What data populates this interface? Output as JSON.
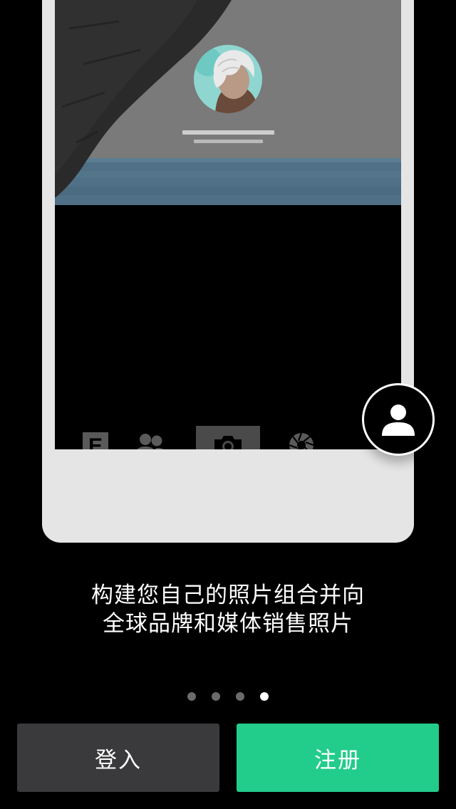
{
  "onboarding": {
    "caption_line1": "构建您自己的照片组合并向",
    "caption_line2": "全球品牌和媒体销售照片",
    "page_indicator": {
      "total": 4,
      "current": 4
    }
  },
  "tabbar": {
    "items": [
      {
        "icon": "editors-choice-icon",
        "label": "E"
      },
      {
        "icon": "people-icon"
      },
      {
        "icon": "camera-icon",
        "active": true
      },
      {
        "icon": "aperture-icon"
      },
      {
        "icon": "profile-icon"
      }
    ]
  },
  "buttons": {
    "login_label": "登入",
    "signup_label": "注册"
  },
  "colors": {
    "background": "#000000",
    "accent_green": "#22cc8b",
    "login_button": "#3a393b",
    "phone_frame": "#e6e5e6"
  }
}
